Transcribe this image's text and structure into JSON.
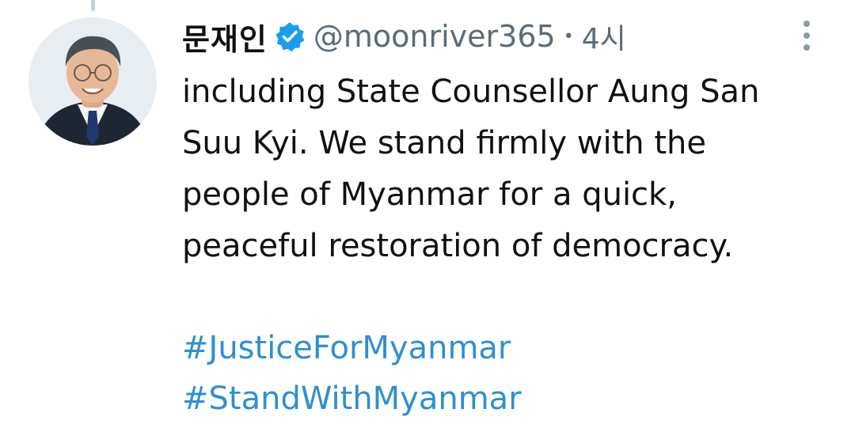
{
  "tweet": {
    "author": {
      "display_name": "문재인",
      "handle": "@moonriver365",
      "verified": true
    },
    "separator": "•",
    "timestamp": "4시",
    "body_lines": [
      "including State Counsellor Aung San",
      "Suu Kyi. We stand firmly with the",
      "people of Myanmar for a quick,",
      "peaceful restoration of democracy."
    ],
    "hashtags": [
      "#JusticeForMyanmar",
      "#StandWithMyanmar"
    ]
  },
  "icons": {
    "verified": "verified-badge-icon",
    "more": "more-vertical-icon"
  },
  "colors": {
    "background": "#ffffff",
    "text": "#111111",
    "muted": "#5b6b77",
    "link": "#2f8fd0",
    "verified": "#1d9bf0"
  }
}
